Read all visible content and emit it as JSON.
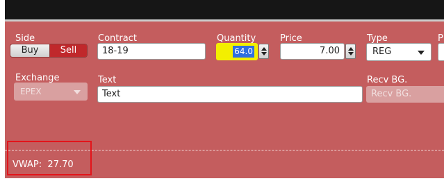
{
  "labels": {
    "side": "Side",
    "contract": "Contract",
    "quantity": "Quantity",
    "price": "Price",
    "type": "Type",
    "next_cut": "P",
    "exchange": "Exchange",
    "text": "Text",
    "recv_bg": "Recv BG."
  },
  "side": {
    "buy": "Buy",
    "sell": "Sell",
    "selected": "Sell"
  },
  "contract": {
    "value": "18-19"
  },
  "quantity": {
    "value": "64.0"
  },
  "price": {
    "value": "7.00"
  },
  "type": {
    "selected": "REG"
  },
  "exchange": {
    "selected": "EPEX"
  },
  "text_field": {
    "value": "Text"
  },
  "recv_bg_field": {
    "placeholder": "Recv BG."
  },
  "vwap": {
    "label": "VWAP:",
    "value": "27.70"
  },
  "colors": {
    "panel": "#c45d5e",
    "sell_active": "#c0282b",
    "highlight_border": "#e3141a",
    "focus_yellow": "#f3ef00"
  }
}
